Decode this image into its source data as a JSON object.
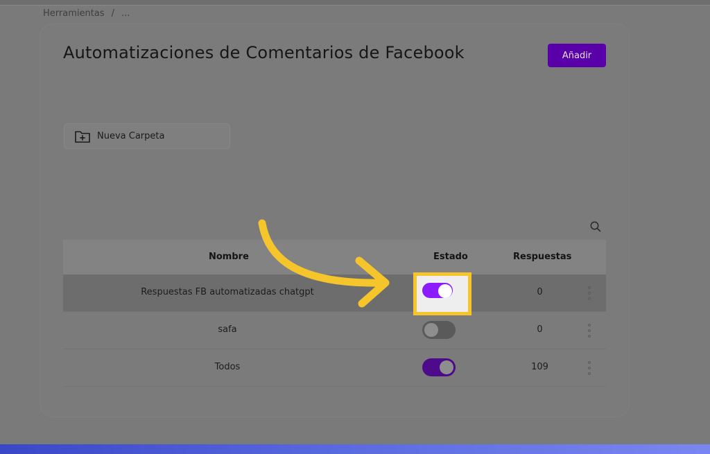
{
  "breadcrumb": {
    "items": [
      "Herramientas",
      "/",
      "..."
    ]
  },
  "page": {
    "title": "Automatizaciones de Comentarios de Facebook"
  },
  "toolbar": {
    "add_label": "Añadir"
  },
  "folder": {
    "new_folder_label": "Nueva Carpeta"
  },
  "table": {
    "headers": {
      "name": "Nombre",
      "status": "Estado",
      "responses": "Respuestas"
    },
    "rows": [
      {
        "name": "Respuestas FB automatizadas chatgpt",
        "status": "on",
        "responses": "0"
      },
      {
        "name": "safa",
        "status": "off",
        "responses": "0"
      },
      {
        "name": "Todos",
        "status": "on",
        "responses": "109"
      }
    ]
  },
  "colors": {
    "accent": "#8c1bff",
    "accent_dim": "#4d0a8a",
    "highlight": "#f5c52b",
    "overlay": "#7b7b7b"
  },
  "icons": {
    "folder": "folder-plus-icon",
    "search": "search-icon",
    "menu": "vertical-dots-icon",
    "annotation": "curved-arrow-icon"
  }
}
